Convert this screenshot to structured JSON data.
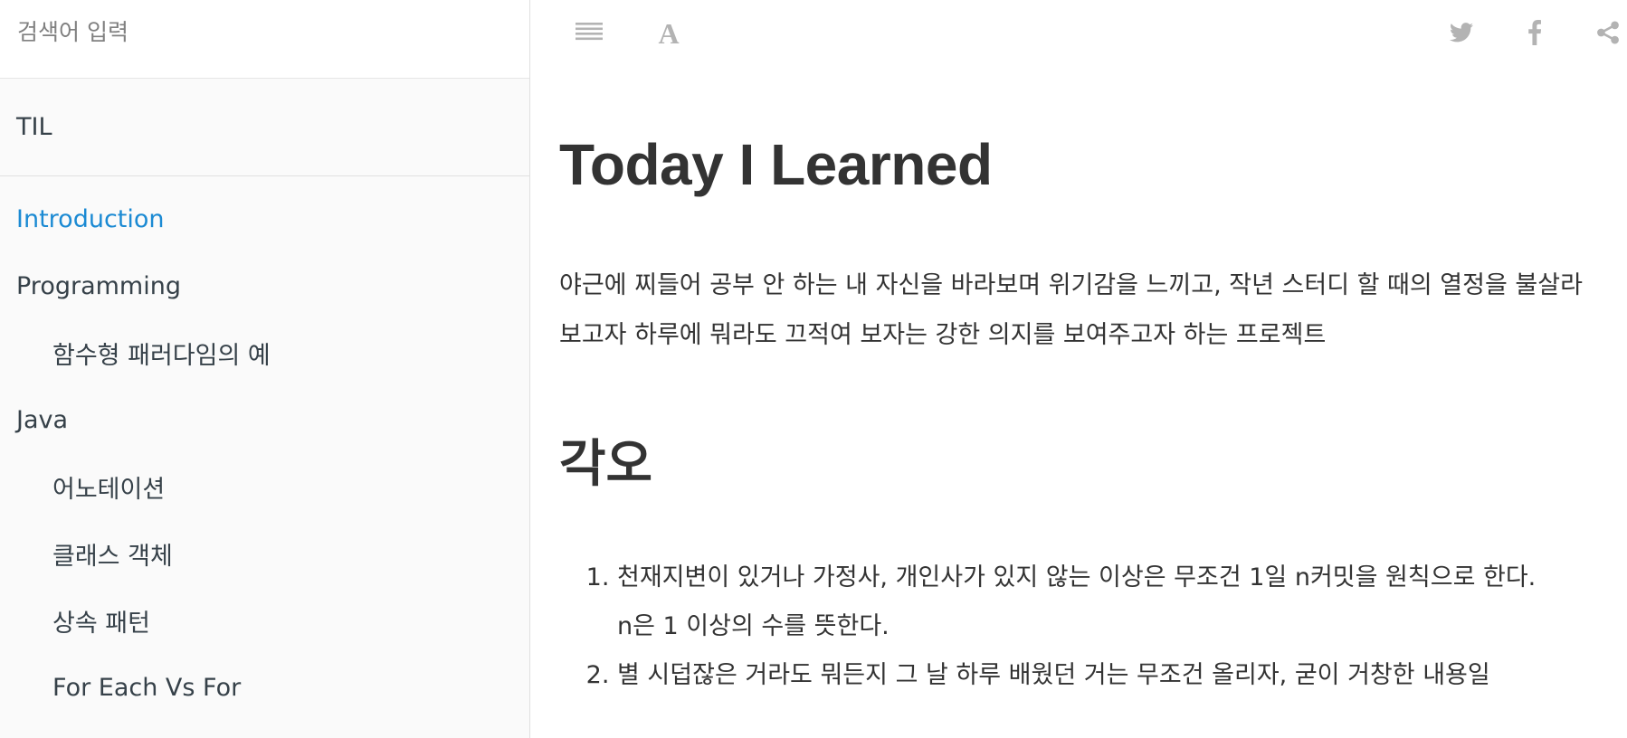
{
  "sidebar": {
    "search_placeholder": "검색어 입력",
    "book_title": "TIL",
    "items": [
      {
        "label": "Introduction",
        "level": 0,
        "active": true
      },
      {
        "label": "Programming",
        "level": 0,
        "active": false
      },
      {
        "label": "함수형 패러다임의 예",
        "level": 1,
        "active": false
      },
      {
        "label": "Java",
        "level": 0,
        "active": false
      },
      {
        "label": "어노테이션",
        "level": 1,
        "active": false
      },
      {
        "label": "클래스 객체",
        "level": 1,
        "active": false
      },
      {
        "label": "상속 패턴",
        "level": 1,
        "active": false
      },
      {
        "label": "For Each Vs For",
        "level": 1,
        "active": false
      }
    ]
  },
  "toolbar": {
    "left_icons": [
      "menu-lines-icon",
      "font-settings-icon"
    ],
    "right_icons": [
      "twitter-icon",
      "facebook-icon",
      "share-icon"
    ]
  },
  "page": {
    "title": "Today I Learned",
    "intro": "야근에 찌들어 공부 안 하는 내 자신을 바라보며 위기감을 느끼고, 작년 스터디 할 때의 열정을 불살라 보고자 하루에 뭐라도 끄적여 보자는 강한 의지를 보여주고자 하는 프로젝트",
    "section_heading": "각오",
    "list": [
      {
        "text": "천재지변이 있거나 가정사, 개인사가 있지 않는 이상은 무조건 1일 n커밋을 원칙으로 한다.",
        "note": "n은 1 이상의 수를 뜻한다."
      },
      {
        "text": "별 시덥잖은 거라도 뭐든지 그 날 하루 배웠던 거는 무조건 올리자, 굳이 거창한 내용일"
      }
    ]
  },
  "colors": {
    "accent": "#1b8ad3",
    "text": "#333333",
    "sidebar_bg": "#fafafa",
    "icon": "#b3b3b3"
  }
}
